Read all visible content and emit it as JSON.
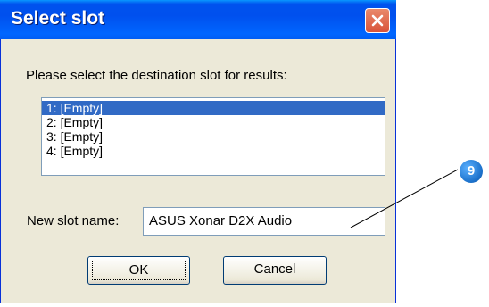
{
  "window": {
    "title": "Select slot"
  },
  "prompt": "Please select the destination slot for results:",
  "slots": [
    {
      "label": "1: [Empty]",
      "selected": true
    },
    {
      "label": "2: [Empty]",
      "selected": false
    },
    {
      "label": "3: [Empty]",
      "selected": false
    },
    {
      "label": "4: [Empty]",
      "selected": false
    }
  ],
  "slot_name": {
    "label": "New slot name:",
    "value": "ASUS Xonar D2X Audio"
  },
  "buttons": {
    "ok": "OK",
    "cancel": "Cancel"
  },
  "callout": {
    "number": "9"
  },
  "icons": {
    "close": "close-icon"
  },
  "colors": {
    "titlebar": "#0053ee",
    "selection": "#316ac5",
    "close": "#d9543a",
    "callout": "#1a6fc9"
  }
}
